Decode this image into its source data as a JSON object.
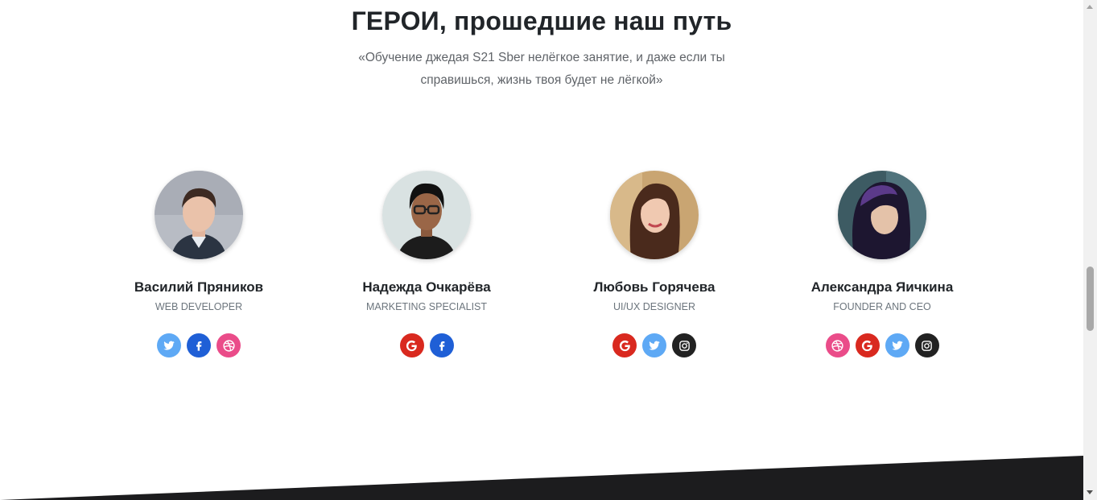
{
  "section": {
    "title": "ГЕРОИ, прошедшие наш путь",
    "subtitle_line1": "«Обучение джедая S21 Sber нелёгкое занятие, и даже если ты",
    "subtitle_line2": "справишься, жизнь твоя будет не лёгкой»"
  },
  "team": [
    {
      "name": "Василий Пряников",
      "role": "Web Developer",
      "socials": [
        "twitter",
        "facebook",
        "dribbble"
      ]
    },
    {
      "name": "Надежда Очкарёва",
      "role": "Marketing Specialist",
      "socials": [
        "google",
        "facebook"
      ]
    },
    {
      "name": "Любовь Горячева",
      "role": "UI/UX Designer",
      "socials": [
        "google",
        "twitter",
        "instagram"
      ]
    },
    {
      "name": "Александра Яичкина",
      "role": "Founder and CEO",
      "socials": [
        "dribbble",
        "google",
        "twitter",
        "instagram"
      ]
    }
  ],
  "social_colors": {
    "twitter": "#5ea9f5",
    "facebook": "#1f5fd6",
    "dribbble": "#ea4c89",
    "google": "#d9291f",
    "instagram": "#222222"
  },
  "footer": {
    "color": "#1c1c1e"
  }
}
